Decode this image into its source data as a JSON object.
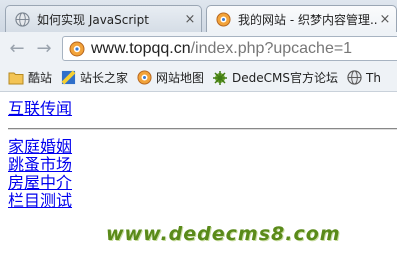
{
  "browser": {
    "tabs": [
      {
        "title": "如何实现 JavaScript",
        "close": "×",
        "icon": "globe-icon",
        "active": false
      },
      {
        "title": "我的网站 - 织梦内容管理...",
        "close": "×",
        "icon": "dedecms-icon",
        "active": true
      }
    ],
    "nav": {
      "back": "←",
      "forward": "→"
    },
    "address": {
      "host": "www.topqq.cn",
      "path": "/index.php?upcache=1"
    },
    "bookmarks": [
      {
        "label": "酷站",
        "icon": "folder-icon"
      },
      {
        "label": "站长之家",
        "icon": "chinaz-icon"
      },
      {
        "label": "网站地图",
        "icon": "dedecms-icon"
      },
      {
        "label": "DedeCMS官方论坛",
        "icon": "dedecms-leaf-icon"
      },
      {
        "label": "Th",
        "icon": "globe-icon"
      }
    ]
  },
  "page": {
    "top_link": "互联传闻",
    "links": [
      "家庭婚姻",
      "跳蚤市场",
      "房屋中介",
      "栏目测试"
    ],
    "watermark": "www.dedecms8.com"
  }
}
